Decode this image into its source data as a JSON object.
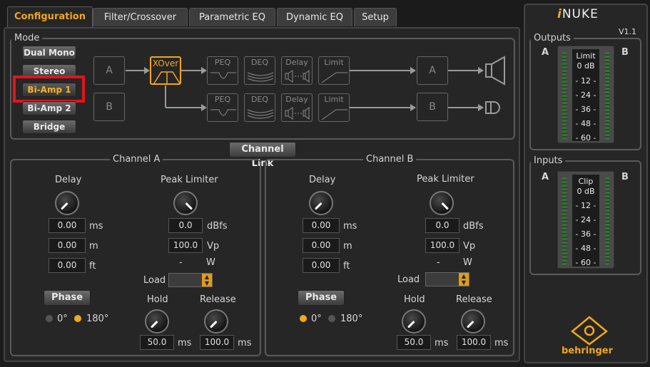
{
  "tabs": [
    {
      "label": "Configuration",
      "active": true
    },
    {
      "label": "Filter/Crossover"
    },
    {
      "label": "Parametric EQ"
    },
    {
      "label": "Dynamic EQ"
    },
    {
      "label": "Setup"
    }
  ],
  "mode": {
    "legend": "Mode",
    "buttons": [
      "Dual Mono",
      "Stereo",
      "Bi-Amp 1",
      "Bi-Amp 2",
      "Bridge"
    ],
    "selected": "Bi-Amp 1"
  },
  "signal_flow": {
    "input_a": "A",
    "input_b": "B",
    "xover": "XOver",
    "peq": "PEQ",
    "deq": "DEQ",
    "delay": "Delay",
    "limit": "Limit",
    "output_a": "A",
    "output_b": "B"
  },
  "channel_link": "Channel Link",
  "channel_a": {
    "legend": "Channel A",
    "delay_label": "Delay",
    "delay_ms": "0.00",
    "delay_ms_unit": "ms",
    "delay_m": "0.00",
    "delay_m_unit": "m",
    "delay_ft": "0.00",
    "delay_ft_unit": "ft",
    "peak_limiter_label": "Peak Limiter",
    "limiter_dbfs": "0.0",
    "limiter_dbfs_unit": "dBfs",
    "limiter_vp": "100.0",
    "limiter_vp_unit": "Vp",
    "limiter_dash": "-",
    "limiter_w_unit": "W",
    "load_label": "Load",
    "phase_label": "Phase",
    "phase_0": "0°",
    "phase_180": "180°",
    "phase_selected": "180°",
    "hold_label": "Hold",
    "hold_value": "50.0",
    "hold_unit": "ms",
    "release_label": "Release",
    "release_value": "100.0",
    "release_unit": "ms"
  },
  "channel_b": {
    "legend": "Channel B",
    "delay_label": "Delay",
    "delay_ms": "0.00",
    "delay_ms_unit": "ms",
    "delay_m": "0.00",
    "delay_m_unit": "m",
    "delay_ft": "0.00",
    "delay_ft_unit": "ft",
    "peak_limiter_label": "Peak Limiter",
    "limiter_dbfs": "0.0",
    "limiter_dbfs_unit": "dBfs",
    "limiter_vp": "100.0",
    "limiter_vp_unit": "Vp",
    "limiter_dash": "-",
    "limiter_w_unit": "W",
    "load_label": "Load",
    "phase_label": "Phase",
    "phase_0": "0°",
    "phase_180": "180°",
    "phase_selected": "0°",
    "hold_label": "Hold",
    "hold_value": "50.0",
    "hold_unit": "ms",
    "release_label": "Release",
    "release_value": "100.0",
    "release_unit": "ms"
  },
  "brand": {
    "logo_prefix": "i",
    "logo_text": "NUKE",
    "version": "V1.1",
    "maker": "behringer"
  },
  "outputs": {
    "legend": "Outputs",
    "left": "A",
    "right": "B",
    "header": "Limit",
    "scale": [
      "0 dB",
      "- 12 -",
      "- 24 -",
      "- 36 -",
      "- 48 -",
      "- 60 -"
    ]
  },
  "inputs": {
    "legend": "Inputs",
    "left": "A",
    "right": "B",
    "header": "Clip",
    "scale": [
      "0 dB",
      "- 12 -",
      "- 24 -",
      "- 36 -",
      "- 48 -",
      "- 60 -"
    ]
  },
  "colors": {
    "accent": "#f0a81c",
    "highlight": "#e0141e",
    "background": "#1b1b1b"
  }
}
